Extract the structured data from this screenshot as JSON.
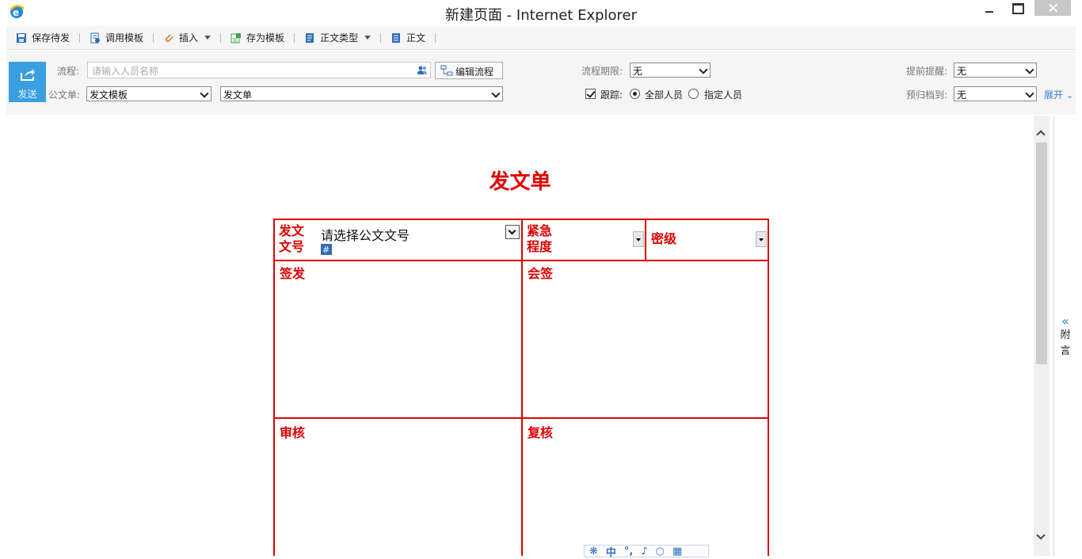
{
  "window": {
    "title": "新建页面 - Internet Explorer"
  },
  "toolbar": {
    "items": [
      {
        "label": "保存待发",
        "icon": "save-icon"
      },
      {
        "label": "调用模板",
        "icon": "template-icon"
      },
      {
        "label": "插入",
        "icon": "attachment-icon",
        "dropdown": true
      },
      {
        "label": "存为模板",
        "icon": "save-as-template-icon"
      },
      {
        "label": "正文类型",
        "icon": "document-type-icon",
        "dropdown": true
      },
      {
        "label": "正文",
        "icon": "document-icon"
      }
    ]
  },
  "header": {
    "send_label": "发送",
    "flow_label": "流程:",
    "flow_placeholder": "请输入人员名称",
    "edit_flow_label": "编辑流程",
    "official_doc_label": "公文单:",
    "template_select": "发文模板",
    "form_select": "发文单",
    "deadline_label": "流程期限:",
    "deadline_value": "无",
    "track_label": "跟踪:",
    "track_checked": true,
    "track_all_label": "全部人员",
    "track_specific_label": "指定人员",
    "reminder_label": "提前提醒:",
    "reminder_value": "无",
    "archive_label": "预归档到:",
    "archive_value": "无",
    "expand_label": "展开"
  },
  "document": {
    "title": "发文单",
    "doc_number_label_1": "发文",
    "doc_number_label_2": "文号",
    "doc_number_placeholder": "请选择公文文号",
    "urgency_label_1": "紧急",
    "urgency_label_2": "程度",
    "secrecy_label": "密级",
    "sign_label": "签发",
    "countersign_label": "会签",
    "review_label": "审核",
    "recheck_label": "复核"
  },
  "side_panel": {
    "label_1": "附",
    "label_2": "言"
  },
  "ime": {
    "lang": "中"
  },
  "colors": {
    "accent": "#3a9fe0",
    "form_red": "#e00000",
    "link_blue": "#2a7fd4"
  }
}
